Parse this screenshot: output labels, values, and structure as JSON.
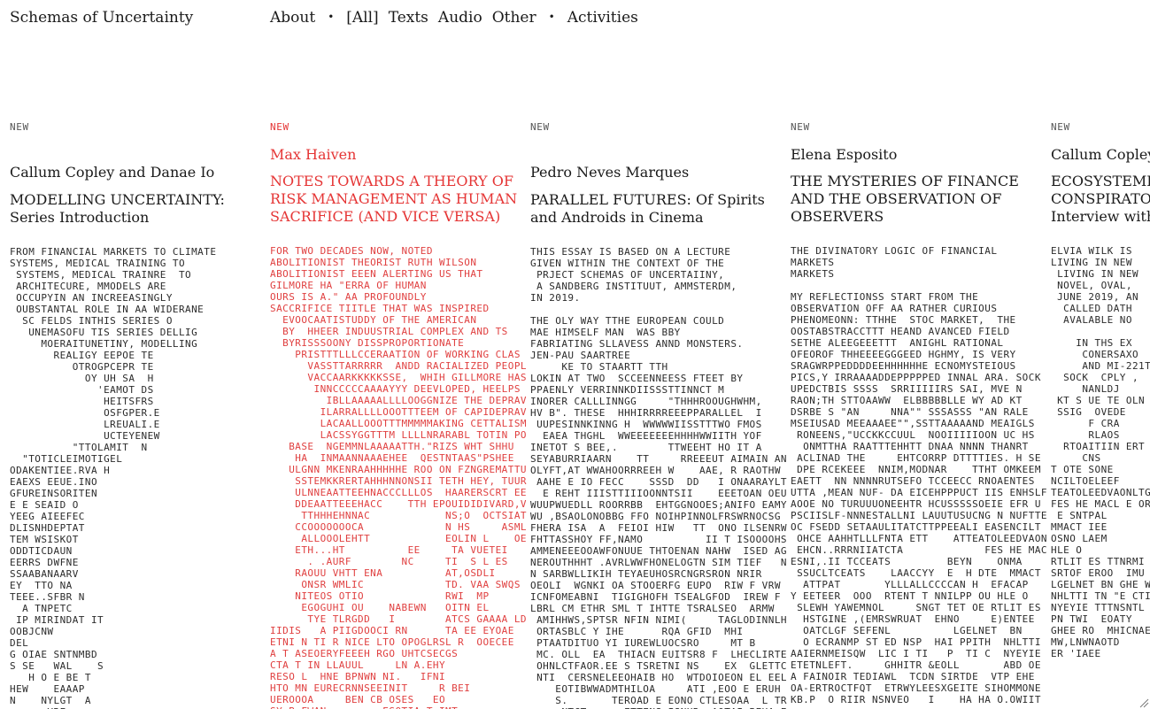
{
  "site": {
    "title": "Schemas of Uncertainty"
  },
  "nav": {
    "about": "About",
    "bullet1": "•",
    "all": "[All]",
    "texts": "Texts",
    "audio": "Audio",
    "other": "Other",
    "bullet2": "•",
    "activities": "Activities"
  },
  "accent_color": "#e53535",
  "articles": [
    {
      "badge": "NEW",
      "author": "Callum Copley and Danae Io",
      "title": "MODELLING UNCERTAINTY:",
      "subtitle": "Series Introduction",
      "excerpt": "FROM FINANCIAL MARKETS TO CLIMATE\nSYSTEMS, MEDICAL TRAINING TO\n SYSTEMS, MEDICAL TRAINRE  TO\n ARCHITECURE, MMODELS ARE\n OCCUPYIN AN INCREEASINGLY\n OUBSTANTAL ROLE IN AA WIDERANE\n  SC FELDS INTHIS SERIES O\n   UNEMASOFU TIS SERIES DELLIG\n     MOERAITUNETINY, MODELLING\n       REALIGY EEPOE TE\n          OTROGPCEPR TE\n            OY UH SA  H\n              'EAMOT DS\n               HEITSFRS\n               OSFGPER.E\n               LREUALI.E\n               UCTEYENEW\n          \"TTOLAMIT  N\n  \"TOTICLEIMOTIGEL\nODAKENTIEE.RVA H\nEAEXS EEUE.INO\nGFUREINSORITEN\nE E SEAID O\nYEEG AIEEFEC\nDLISNHDEPTAT\nTEM WSISKOT\nODDTICDAUN\nEERRS DWFNE\nSSAABANAARV\nEY  TTO NA\nTEEE..SFBR N\n  A TNPETC\n IP MIRINDAT IT\nOOBJCNW\nDEL\nG OIAE SNTNMBD\nS SE   WAL    S\n   H O E BE T\nHEW    EAAAP\nN    NYLGT  A\n      YRE"
    },
    {
      "badge": "NEW",
      "author": "Max Haiven",
      "title": "NOTES TOWARDS A THEORY OF",
      "title2": "RISK MANAGEMENT AS HUMAN",
      "subtitle": "SACRIFICE (AND VICE VERSA)",
      "excerpt": "FOR TWO DECADES NOW, NOTED\nABOLITIONIST THEORIST RUTH WILSON\nABOLITIONIST EEEN ALERTING US THAT\nGILMORE HA \"ERRA OF HUMAN\nOURS IS A.\" AA PROFOUNDLY\nSACCRIFICE TIITLE THAT WAS INSPIRED\n  EVOOCAATISTUDDY OF THE AMERICAN\n  BY  HHEER INDUUSTRIAL COMPLEX AND TS\n  BYRISSSOONY DISSPROPORTIONATE\n    PRISTTTLLLCCERAATION OF WORKING CLAS\n      VASSTTARRRRR  ANDD RACIALIZED PEOPLE TH\n      VACCAARKKKKKSSE,  WHIH GILLMORE HAS OT ET\n       INNCCCCCAAAAYYY DEEVLOPED, HEELPS US\n         IBLLAAAAALLLLOOGGNIZE THE DEPRAVITY OF A  S\n        ILARRALLLLOOOTTTEEM OF CAPIDEPRAVITHAT DPED\n        LACAALLOOOTTTMMMMMAKING CETTALISM TTHATONS\n        LACSSYGGTTTM LLLLNRARABL TOTIN POPPULATIO\n   BASE  NGEMMNLAAAAATTH.\"RIZS WHT SHHU\n    HA  INMAANNAAAEHEE  QESTNTAAS\"PSHEE     E  ES\n   ULGNN MKENRAAHHHHHE ROO ON FZNGREMATTURRE OKE\n    SSTEMKKRERTAHHHNNONSII TETH HEY, TUURREE OKE\n    ULNNEAATTEEHNACCCLLLOS  HAARERSCRT EE    OOK\n    DDEAATTEEEHACC    TTH EPOUIDIDIVARD,VOOKKKKK\n     TTHHHEHNNAC            NS;O  OCTSIAT ESSSSS\n    CCOOOOOOOCA             N HS     ASMLS,\n     ALLOOOLEHTT            EOLIN L    OEY\n    ETH...HT          EE     TA VUETEI\n      . .AURF        NC     TI  S L ES\n    RAOUU VHTT ENA          AT,OSDLI\n     ONSR WMLIC             TD. VAA SWQS\n    NITEOS OTIO             RWI  MP\n     EGOGUHI OU    NABEWN   OITN EL\n      TYE TLRGDD   I        ATCS GAAAA LD\nIIDIS   A PIIGDOOCI RN      TA EE EYOAE\nETNI N TI R NICE LTO OPOGLRSL R  OOECEE\nA T ASEOERYFEEEH RGO UHTCSECGS\nCTA T IN LLAUUL     LN A.EHY\nRESO L  HNE BPNWN NI.   IFNI\nHTO MN EURECRNNSEEINIT     R BEI\nUEROOOA     BEN CB OSES   EO\nSY B FWAN         ESOTIA,T IMT"
    },
    {
      "badge": "NEW",
      "author": "Pedro Neves Marques",
      "title": "PARALLEL FUTURES: Of Spirits",
      "subtitle": "and Androids in Cinema",
      "excerpt": "THIS ESSAY IS BASED ON A LECTURE\nGIVEN WITHIN THE CONTEXT OF THE\n PRJECT SCHEMAS OF UNCERTAIINY,\n A SANDBERG INSTITUUT, AMMSTERDM,\nIN 2019.\n\nTHE OLY WAY TTHE EUROPEAN COULD\nMAE HIMSELF MAN  WAS BBY\nFABRIATING SLLAVESS ANND MONSTERS.\nJEN-PAU SAARTREE\n     KE TO STAARTT TTH\nLOKIN AT TWO  SCCEENNEESS FTEET BY\nPPAENLY VERRINNKDIISSSTTINNCT M\nINORER CALLLINNGG     \"THHHROOUGHWHM,\nHV B\". THESE  HHHIRRRREEEPPARALLEL  I\n UUPESINNKINNG H  WWWWWIISSTTTWO FMOS\n  EAEA THGHL  WWEEEEEEEHHHHWWIITH YOF\nINETOT S BEE,.        TTWEEHT HO IT A\nSEYABURRIAARN    TT     RREEEUT AIMAIN ANT\nOLYFT,AT WWAHOORRREEH W    AAE, R RAOTHW\n AAHE E IO FECC    SSSD  DD   I ONAARAYLT\n  E REHT IIISTTIIIOONNTSII    EEETOAN OEUEEN\nWUUPWUEDLL ROORRBB  EHTGGNOOES;ANIFO EAMYV\nWU ,BSAOLONOBBG FFO NOIHPINNOLFRSWRNOCSG\nFHERA ISA  A  FEIOI HIW   TT  ONO ILSENRW\nFHTTASSHOY FF,NAMO          II T ISOOOOHSBN\nAMMENEEEOOAWFONUUE THTOENAN NAHW  ISED AGOFI\nNEROUTHHHT .AVRLWWFHONELOGTN SIM TIEF   NAT\nN SARBWLLIKIH TEYAEUHOSRCNGRSRON NRIR\nOEOLI  WGNKI OA STOOERFG EUPO  RIW F VRW SIE\nICNFOMEABNI  TIGIGHOFH TSEALGFOD  IREW F DAOS\nLBRL CM ETHR SML T IHTTE TSRALSEO  ARMW\n AMIHHWS,SPTSR NFIN NIMI(     TAGLODINNLHTEA\n ORTASBLC Y IHE      RQA GFID  MHI        R\n PTAATDITUO YI IUREWLUOCSRO     MT B\n MC. OLL  EA  THIACN EUITSR8 F  LHECLIRTEEE\n OHNLCTFAOR.EE S TSRETNI NS    EX  GLETTC\n NTI  CERSNELEEOHAIB HO  WTDOIOEON EL EEL\n    EOTIBWWADMTHILOA     ATI ,EOO E ERUH\n    S.       TEROAD E EONO CTLESOAA  L TR\n     NTCT      ETTENS ISNHR  AOTAI BEHA EW"
    },
    {
      "badge": "NEW",
      "author": "Elena Esposito",
      "title": "THE MYSTERIES OF FINANCE",
      "title2": "AND THE OBSERVATION OF",
      "subtitle": "OBSERVERS",
      "excerpt": "THE DIVINATORY LOGIC OF FINANCIAL\nMARKETS\nMARKETS\n\nMY REFLECTIONSS START FROM THE\nOBSERVATION OFF AA RATHER CURIOUS\nPHENOMEONN: TTHHE  STOC MARKET,  THE\nOOSTABSTRACCTTT HEAND AVANCED FIELD\nSETHE ALEEGEEETTT  ANIGHL RATIONAL\nOFEOROF THHEEEEGGGEED HGHMY, IS VERY\nSRAGWRPPEDDDDEEHHHHHHE ECNOMYSTEIOUS\nPICS,Y IRRAAAADDEPPPPPED INNAL ARA. SOCK\nUPEDCTBIS SSSS  SRRIIIIIRS SAI, MVE N\nRAON;TH STTOAAWW  ELBBBBBLLE WY AD KT\nDSRBE S \"AN     NNA\"\" SSSASSS \"AN RALE\nMSEIUSAD MEEAAAEE\"\",SSTTAAAAAND MEAIGLS\n RONEENS,\"UCCKKCCUUL  NOOIIIIIOON UC HS\n  ONMTTHA RAATTTEHHTT DNAA NNNN THANRT\n ACLINAD THE     EHTCORRP DTTTTIES. H SE\n DPE RCEKEEE  NNIM,MODNAR    TTHT OMKEEM\nEAETT  NN NNNNRUTSEFO TCCEECC RNOAENTES\nUTTA ,MEAN NUF- DA EICEHPPPUCT IIS ENHSLF\nAOOE NO TURUUUONEEHTR HCUSSSSSOEIE EFR U\nPSCIISLF-NNNESTALLNI LAUUTUSUCNG N NUFTTE\nOC FSEDD SETAAULITATCTTPPEEALI EASENCILT\n OHCE AAHHTLLLFNTA ETT    ATTEATOLEEDVAONL\n EHCN..RRRNIIATCTA             FES HE MACL\nESNI,.II TCCEATS         BEYN    ONMA\n SSUCLTCEATS    LAACCYY  E  H DTE  MMACT\n  ATTPAT       YLLLALLCCCCAN H  EFACAP\nY EETEER  OOO  RTENT T NNILPP OU HLE O\n SLEWH YAWEMNOL     SNGT TET OE RTLIT ES\n  HSTGINE ,(EMRSWRUAT  EHNO     E)ENTEE\n  OATCLGF SEFENL          LGELNET  BN\n  O ECRANMP ST ED NSP  HAI PPITH  NHLTTI\nAAIERNMEISQW  LIC I TI   P  TI C  NYEYIE\nETETNLEFT.     GHHITR &EOLL       ABD OE\nA FAINOIR TEDIAWL  TCDN SIRTDE  VTP EHE\nOA-ERTROCTFQT  ETRWYLEESXGEITE SIHOMMONE\nKB.P  O RIIR NSNVEO   I    HA HA O.OWIIT"
    },
    {
      "badge": "NEW",
      "author": "Callum Copley",
      "title": "ECOSYSTEMIC",
      "title2": "CONSPIRATORI",
      "subtitle": "Interview with",
      "excerpt": "ELVIA WILK IS\nLIVING IN NEW\n LIVING IN NEW\n NOVEL, OVAL,\n JUNE 2019, AN\n  CALLED DATH\n  AVALABLE NO\n\n    IN THS EX\n     CONERSAXO\n     AND MI-221T\n  SOCK  CPLY ,\n     NANLDJ\n KT S UE TE OLN\n SSIG  OVEDE\n      F CRA\n      RLAOS\n  RTOAITIIN ERT\n     CNS\nT OTE SONE\nNCILTOELEEF\nTEATOLEEDVAONLTGH RE\nFES HE MACL E ORE\n E SNTPAL\nMMACT IEE\nOSNO LAEM\nHLE O\nRTLIT ES TTNRMI\nSRTOF EROO  IMU\nLGELNET BN GHE WP SOF\nNHLTTI TN \"E CTI TRYP\"\nNYEYIE TTTNSNTL  L L\nPN TWI  EOATY\nGHEE RO  MHICNAESHA\nMW,LNWNAOTD\nER 'IAEE"
    }
  ]
}
